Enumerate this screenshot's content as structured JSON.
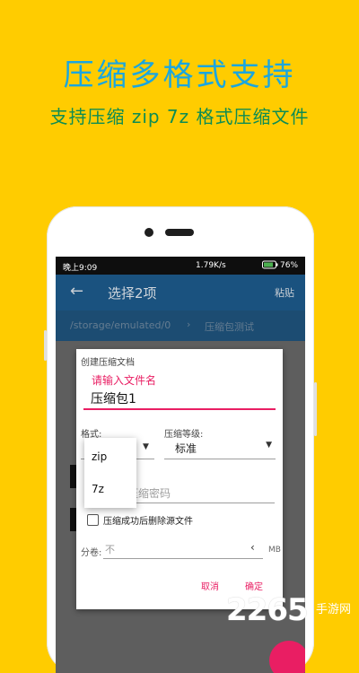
{
  "promo": {
    "title": "压缩多格式支持",
    "subtitle": "支持压缩 zip 7z 格式压缩文件"
  },
  "status_bar": {
    "time": "晚上9:09",
    "speed": "1.79K/s",
    "battery_pct": "76%"
  },
  "appbar": {
    "back_icon": "arrow-left-icon",
    "title": "选择2项",
    "paste_label": "粘贴"
  },
  "path": {
    "root": "/storage/emulated/0",
    "current": "压缩包测试"
  },
  "dialog": {
    "title": "创建压缩文档",
    "name_hint": "请输入文件名",
    "name_value": "压缩包1",
    "format_label": "格式:",
    "level_label": "压缩等级:",
    "level_value": "标准",
    "password_placeholder": "压缩密码",
    "delete_source_label": "压缩成功后删除源文件",
    "split_label": "分卷:",
    "split_placeholder": "不",
    "split_unit": "MB",
    "cancel_label": "取消",
    "ok_label": "确定"
  },
  "format_menu": {
    "options": [
      "zip",
      "7z"
    ]
  },
  "watermark": {
    "number": "2265",
    "cn": "手游网",
    "url": ""
  },
  "colors": {
    "background": "#FFCC00",
    "title": "#1AA6DF",
    "subtitle": "#0D8C53",
    "appbar": "#1A527F",
    "accent": "#E91E63"
  }
}
